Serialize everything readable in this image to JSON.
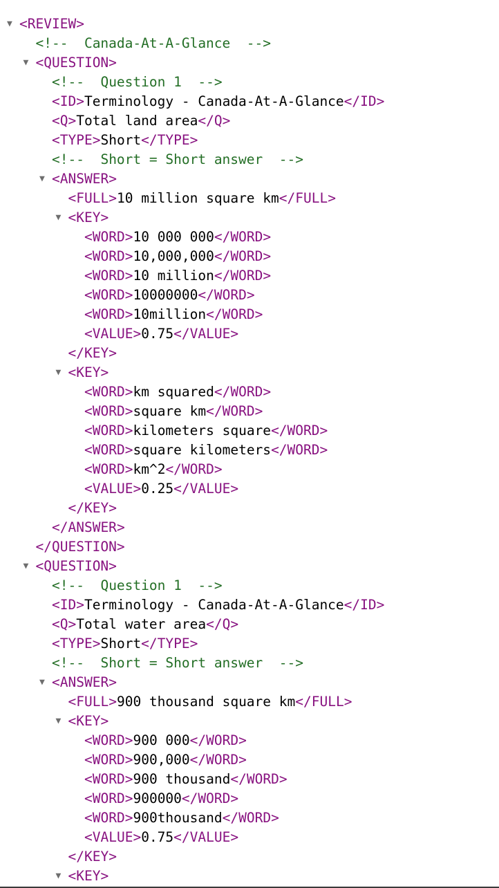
{
  "toggle_glyph": "▼",
  "colors": {
    "tag": "#881280",
    "comment": "#236e25",
    "text": "#000000",
    "toggle": "#6e6e6e"
  },
  "lines": [
    {
      "depth": 0,
      "toggle": true,
      "kind": "open",
      "tag": "REVIEW"
    },
    {
      "depth": 1,
      "toggle": false,
      "kind": "comment",
      "text": "Canada-At-A-Glance"
    },
    {
      "depth": 1,
      "toggle": true,
      "kind": "open",
      "tag": "QUESTION"
    },
    {
      "depth": 2,
      "toggle": false,
      "kind": "comment",
      "text": "Question 1"
    },
    {
      "depth": 2,
      "toggle": false,
      "kind": "element",
      "tag": "ID",
      "text": "Terminology - Canada-At-A-Glance"
    },
    {
      "depth": 2,
      "toggle": false,
      "kind": "element",
      "tag": "Q",
      "text": "Total land area"
    },
    {
      "depth": 2,
      "toggle": false,
      "kind": "element",
      "tag": "TYPE",
      "text": "Short"
    },
    {
      "depth": 2,
      "toggle": false,
      "kind": "comment",
      "text": "Short = Short answer"
    },
    {
      "depth": 2,
      "toggle": true,
      "kind": "open",
      "tag": "ANSWER"
    },
    {
      "depth": 3,
      "toggle": false,
      "kind": "element",
      "tag": "FULL",
      "text": "10 million square km"
    },
    {
      "depth": 3,
      "toggle": true,
      "kind": "open",
      "tag": "KEY"
    },
    {
      "depth": 4,
      "toggle": false,
      "kind": "element",
      "tag": "WORD",
      "text": "10 000 000"
    },
    {
      "depth": 4,
      "toggle": false,
      "kind": "element",
      "tag": "WORD",
      "text": "10,000,000"
    },
    {
      "depth": 4,
      "toggle": false,
      "kind": "element",
      "tag": "WORD",
      "text": "10 million"
    },
    {
      "depth": 4,
      "toggle": false,
      "kind": "element",
      "tag": "WORD",
      "text": "10000000"
    },
    {
      "depth": 4,
      "toggle": false,
      "kind": "element",
      "tag": "WORD",
      "text": "10million"
    },
    {
      "depth": 4,
      "toggle": false,
      "kind": "element",
      "tag": "VALUE",
      "text": "0.75"
    },
    {
      "depth": 3,
      "toggle": false,
      "kind": "close",
      "tag": "KEY"
    },
    {
      "depth": 3,
      "toggle": true,
      "kind": "open",
      "tag": "KEY"
    },
    {
      "depth": 4,
      "toggle": false,
      "kind": "element",
      "tag": "WORD",
      "text": "km squared"
    },
    {
      "depth": 4,
      "toggle": false,
      "kind": "element",
      "tag": "WORD",
      "text": "square km"
    },
    {
      "depth": 4,
      "toggle": false,
      "kind": "element",
      "tag": "WORD",
      "text": "kilometers square"
    },
    {
      "depth": 4,
      "toggle": false,
      "kind": "element",
      "tag": "WORD",
      "text": "square kilometers"
    },
    {
      "depth": 4,
      "toggle": false,
      "kind": "element",
      "tag": "WORD",
      "text": "km^2"
    },
    {
      "depth": 4,
      "toggle": false,
      "kind": "element",
      "tag": "VALUE",
      "text": "0.25"
    },
    {
      "depth": 3,
      "toggle": false,
      "kind": "close",
      "tag": "KEY"
    },
    {
      "depth": 2,
      "toggle": false,
      "kind": "close",
      "tag": "ANSWER"
    },
    {
      "depth": 1,
      "toggle": false,
      "kind": "close",
      "tag": "QUESTION"
    },
    {
      "depth": 1,
      "toggle": true,
      "kind": "open",
      "tag": "QUESTION"
    },
    {
      "depth": 2,
      "toggle": false,
      "kind": "comment",
      "text": "Question 1"
    },
    {
      "depth": 2,
      "toggle": false,
      "kind": "element",
      "tag": "ID",
      "text": "Terminology - Canada-At-A-Glance"
    },
    {
      "depth": 2,
      "toggle": false,
      "kind": "element",
      "tag": "Q",
      "text": "Total water area"
    },
    {
      "depth": 2,
      "toggle": false,
      "kind": "element",
      "tag": "TYPE",
      "text": "Short"
    },
    {
      "depth": 2,
      "toggle": false,
      "kind": "comment",
      "text": "Short = Short answer"
    },
    {
      "depth": 2,
      "toggle": true,
      "kind": "open",
      "tag": "ANSWER"
    },
    {
      "depth": 3,
      "toggle": false,
      "kind": "element",
      "tag": "FULL",
      "text": "900 thousand square km"
    },
    {
      "depth": 3,
      "toggle": true,
      "kind": "open",
      "tag": "KEY"
    },
    {
      "depth": 4,
      "toggle": false,
      "kind": "element",
      "tag": "WORD",
      "text": "900 000"
    },
    {
      "depth": 4,
      "toggle": false,
      "kind": "element",
      "tag": "WORD",
      "text": "900,000"
    },
    {
      "depth": 4,
      "toggle": false,
      "kind": "element",
      "tag": "WORD",
      "text": "900 thousand"
    },
    {
      "depth": 4,
      "toggle": false,
      "kind": "element",
      "tag": "WORD",
      "text": "900000"
    },
    {
      "depth": 4,
      "toggle": false,
      "kind": "element",
      "tag": "WORD",
      "text": "900thousand"
    },
    {
      "depth": 4,
      "toggle": false,
      "kind": "element",
      "tag": "VALUE",
      "text": "0.75"
    },
    {
      "depth": 3,
      "toggle": false,
      "kind": "close",
      "tag": "KEY"
    },
    {
      "depth": 3,
      "toggle": true,
      "kind": "open",
      "tag": "KEY"
    }
  ]
}
